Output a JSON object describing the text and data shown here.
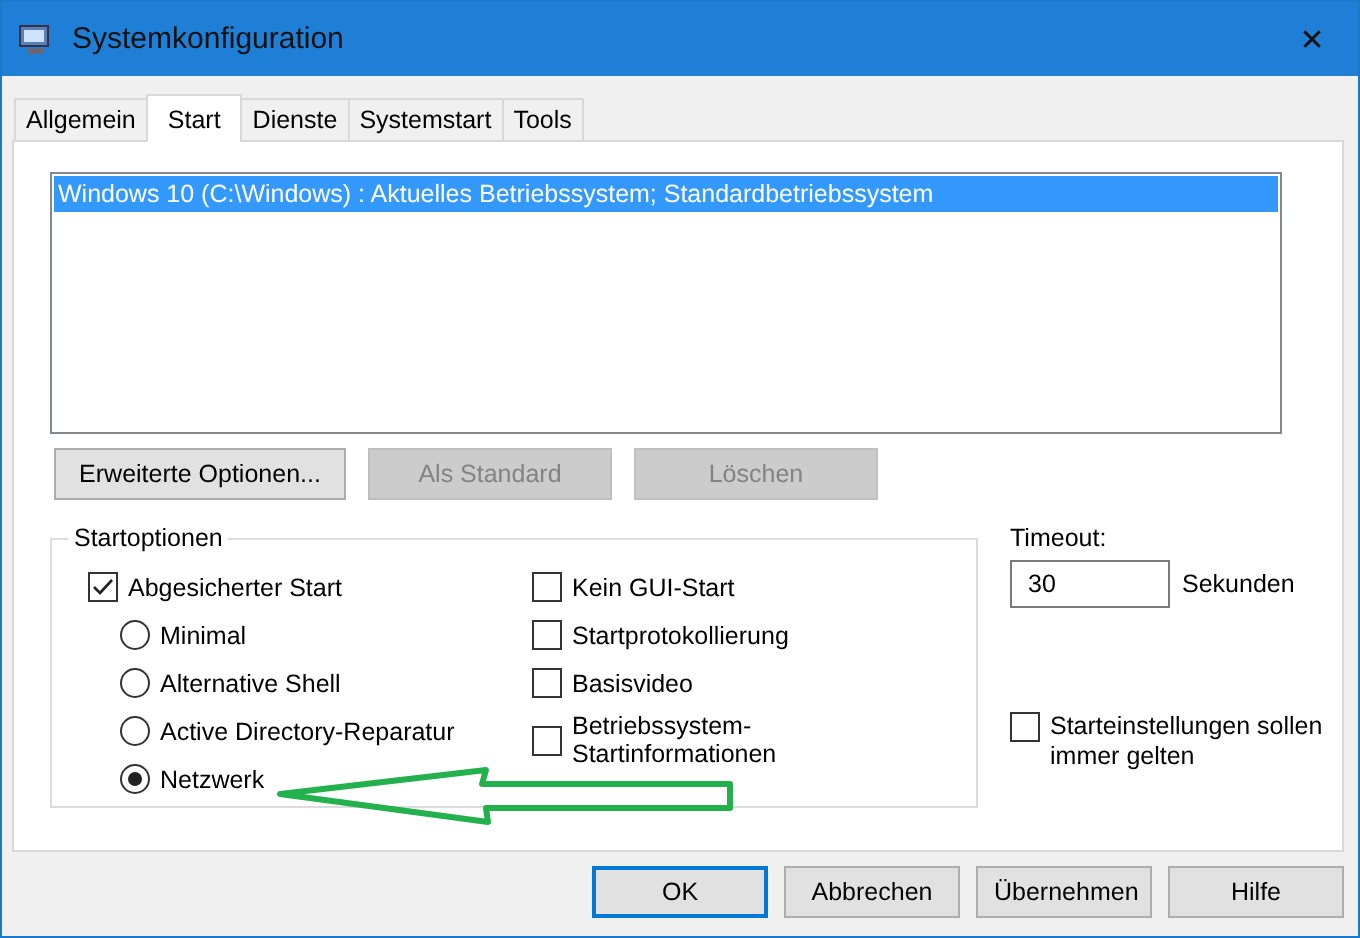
{
  "window": {
    "title": "Systemkonfiguration",
    "close": "✕"
  },
  "tabs": [
    {
      "label": "Allgemein",
      "selected": false
    },
    {
      "label": "Start",
      "selected": true
    },
    {
      "label": "Dienste",
      "selected": false
    },
    {
      "label": "Systemstart",
      "selected": false
    },
    {
      "label": "Tools",
      "selected": false
    }
  ],
  "boot_list": {
    "items": [
      {
        "label": "Windows 10 (C:\\Windows) : Aktuelles Betriebssystem; Standardbetriebssystem",
        "selected": true
      }
    ]
  },
  "boot_buttons": [
    {
      "label": "Erweiterte Optionen...",
      "disabled": false
    },
    {
      "label": "Als Standard",
      "disabled": true
    },
    {
      "label": "Löschen",
      "disabled": true
    }
  ],
  "startoptions": {
    "title": "Startoptionen",
    "safe_boot": {
      "label": "Abgesicherter Start",
      "checked": true
    },
    "modes": [
      {
        "label": "Minimal",
        "selected": false
      },
      {
        "label": "Alternative Shell",
        "selected": false
      },
      {
        "label": "Active Directory-Reparatur",
        "selected": false
      },
      {
        "label": "Netzwerk",
        "selected": true
      }
    ],
    "options": [
      {
        "label": "Kein GUI-Start",
        "checked": false
      },
      {
        "label": "Startprotokollierung",
        "checked": false
      },
      {
        "label": "Basisvideo",
        "checked": false
      },
      {
        "label": "Betriebssystem-\nStartinformationen",
        "checked": false
      }
    ]
  },
  "timeout": {
    "label": "Timeout:",
    "value": "30",
    "unit": "Sekunden"
  },
  "persist": {
    "label": "Starteinstellungen sollen immer gelten",
    "checked": false
  },
  "dialog_buttons": [
    {
      "label": "OK",
      "default": true
    },
    {
      "label": "Abbrechen",
      "default": false
    },
    {
      "label": "Übernehmen",
      "default": false
    },
    {
      "label": "Hilfe",
      "default": false
    }
  ]
}
